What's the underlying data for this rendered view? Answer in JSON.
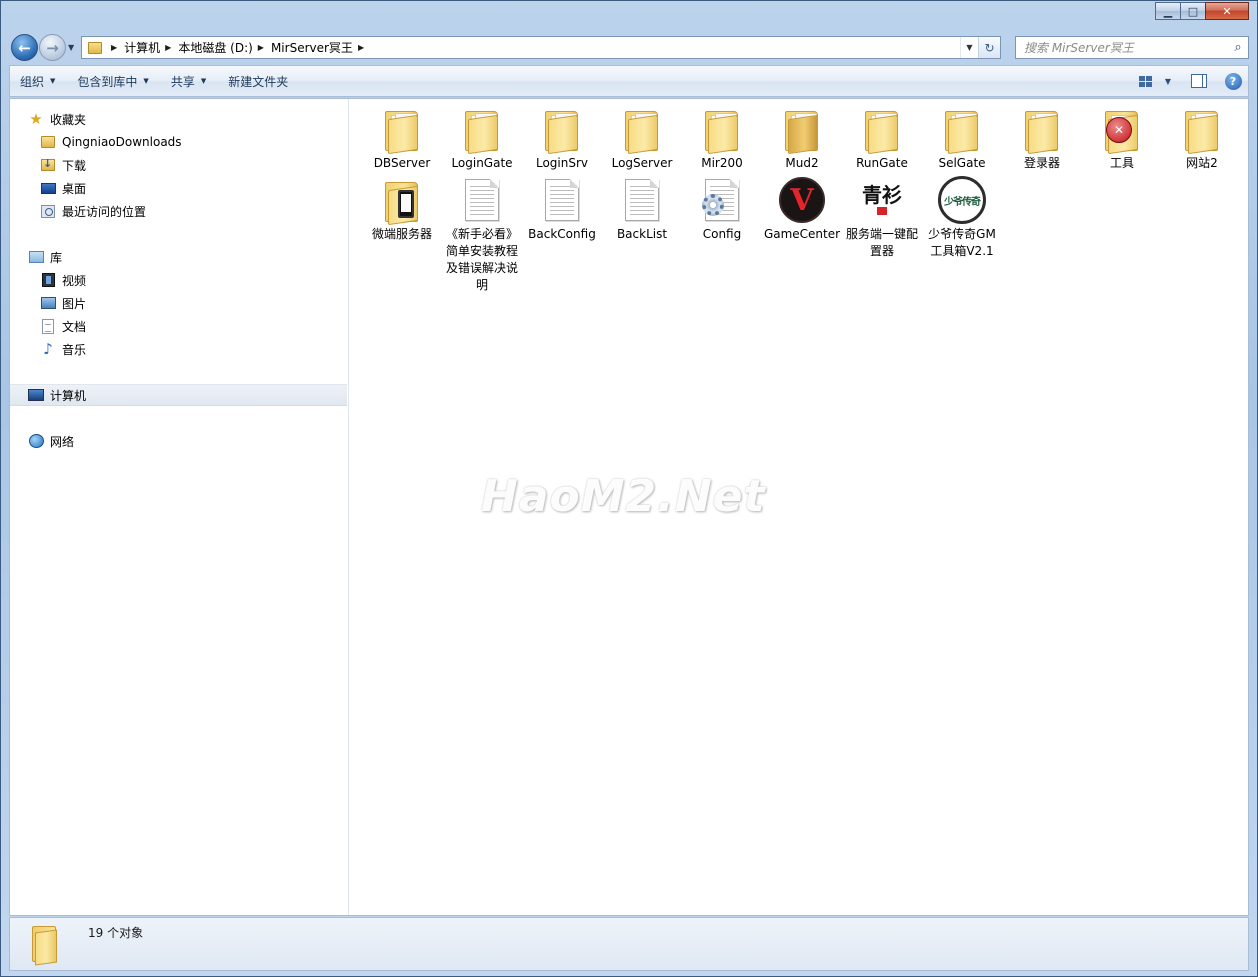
{
  "window": {
    "caption_minimize": "▁",
    "caption_maximize": "□",
    "caption_close": "✕"
  },
  "address": {
    "breadcrumbs": [
      "计算机",
      "本地磁盘 (D:)",
      "MirServer冥王"
    ]
  },
  "search": {
    "placeholder": "搜索 MirServer冥王"
  },
  "toolbar": {
    "organize": "组织",
    "include_in_library": "包含到库中",
    "share": "共享",
    "new_folder": "新建文件夹"
  },
  "nav_pane": {
    "favorites": "收藏夹",
    "fav_items": [
      "QingniaoDownloads",
      "下载",
      "桌面",
      "最近访问的位置"
    ],
    "libraries": "库",
    "lib_items": [
      "视频",
      "图片",
      "文档",
      "音乐"
    ],
    "computer": "计算机",
    "network": "网络"
  },
  "files": [
    {
      "name": "DBServer",
      "icon": "folder-icon"
    },
    {
      "name": "LoginGate",
      "icon": "folder-icon"
    },
    {
      "name": "LoginSrv",
      "icon": "folder-icon"
    },
    {
      "name": "LogServer",
      "icon": "folder-icon"
    },
    {
      "name": "Mir200",
      "icon": "folder-icon"
    },
    {
      "name": "Mud2",
      "icon": "folder-icon"
    },
    {
      "name": "RunGate",
      "icon": "folder-icon"
    },
    {
      "name": "SelGate",
      "icon": "folder-icon"
    },
    {
      "name": "登录器",
      "icon": "folder-icon"
    },
    {
      "name": "工具",
      "icon": "folder-tool-icon"
    },
    {
      "name": "网站2",
      "icon": "folder-icon"
    },
    {
      "name": "微端服务器",
      "icon": "folder-phone-icon"
    },
    {
      "name": "《新手必看》简单安装教程及错误解决说明",
      "icon": "text-document-icon"
    },
    {
      "name": "BackConfig",
      "icon": "text-document-icon"
    },
    {
      "name": "BackList",
      "icon": "text-document-icon"
    },
    {
      "name": "Config",
      "icon": "config-file-icon"
    },
    {
      "name": "GameCenter",
      "icon": "gamecenter-app-icon"
    },
    {
      "name": "服务端一键配置器",
      "icon": "qingshan-app-icon"
    },
    {
      "name": "少爷传奇GM工具箱V2.1",
      "icon": "shaoye-app-icon"
    }
  ],
  "app_logo_text": {
    "gamecenter": "V",
    "qingshan": "青衫",
    "shaoye": "少爷传奇",
    "tool_badge": "✕"
  },
  "watermark": "HaoM2.Net",
  "status": {
    "count_text": "19 个对象"
  }
}
